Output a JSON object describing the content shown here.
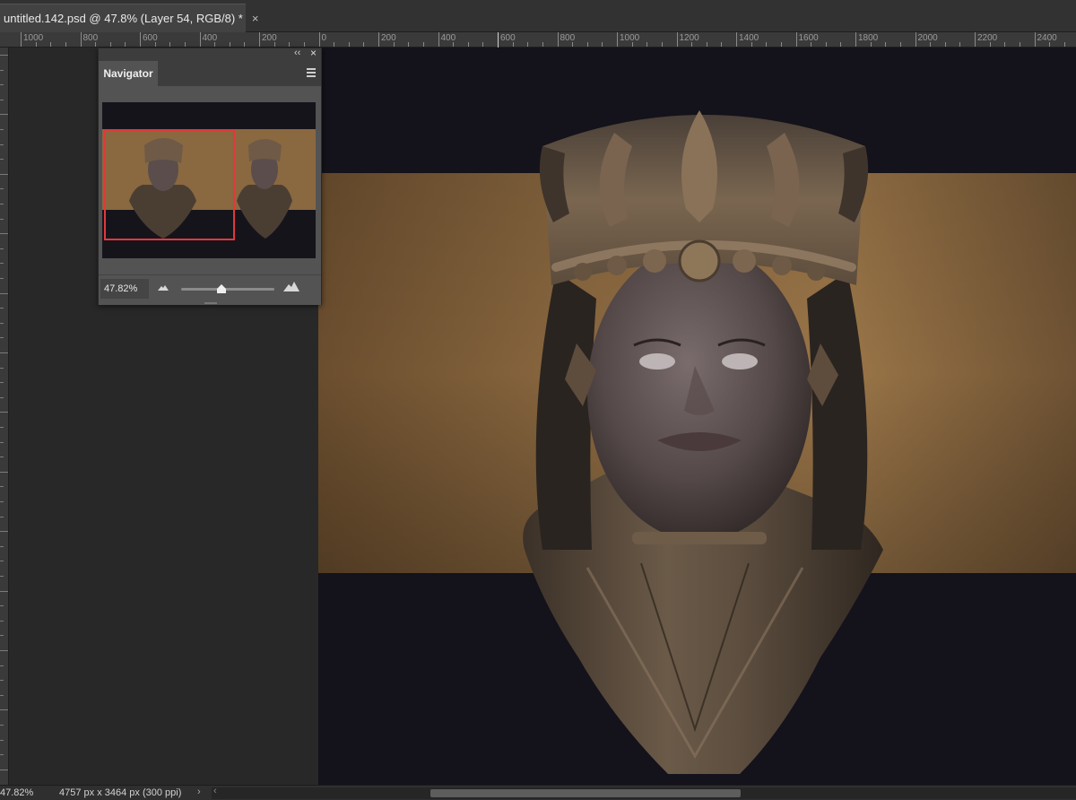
{
  "document_tab": {
    "title": "untitled.142.psd @ 47.8% (Layer 54, RGB/8) *",
    "close_glyph": "×"
  },
  "ruler": {
    "labels": [
      "1000",
      "800",
      "600",
      "400",
      "200",
      "0",
      "200",
      "400",
      "600",
      "800",
      "1000",
      "1200",
      "1400",
      "1600",
      "1800",
      "2000",
      "2200",
      "2400"
    ]
  },
  "navigator": {
    "tab_label": "Navigator",
    "collapse_glyph": "‹‹",
    "close_glyph": "×",
    "zoom_value": "47.82%",
    "zoom_level": 0.43,
    "view_frame_color": "#e0393b"
  },
  "status": {
    "zoom": "47.82%",
    "doc_info": "4757 px x 3464 px (300 ppi)",
    "arrow_glyph": "›",
    "scroll_left_glyph": "‹"
  },
  "colors": {
    "app_bg": "#282828",
    "panel_bg": "#535353",
    "canvas_bg": "#14121a",
    "backdrop_band": "#8a6a45"
  },
  "icons": {
    "zoom_out": "small-mountain-icon",
    "zoom_in": "large-mountain-icon",
    "panel_menu": "hamburger-menu-icon"
  }
}
